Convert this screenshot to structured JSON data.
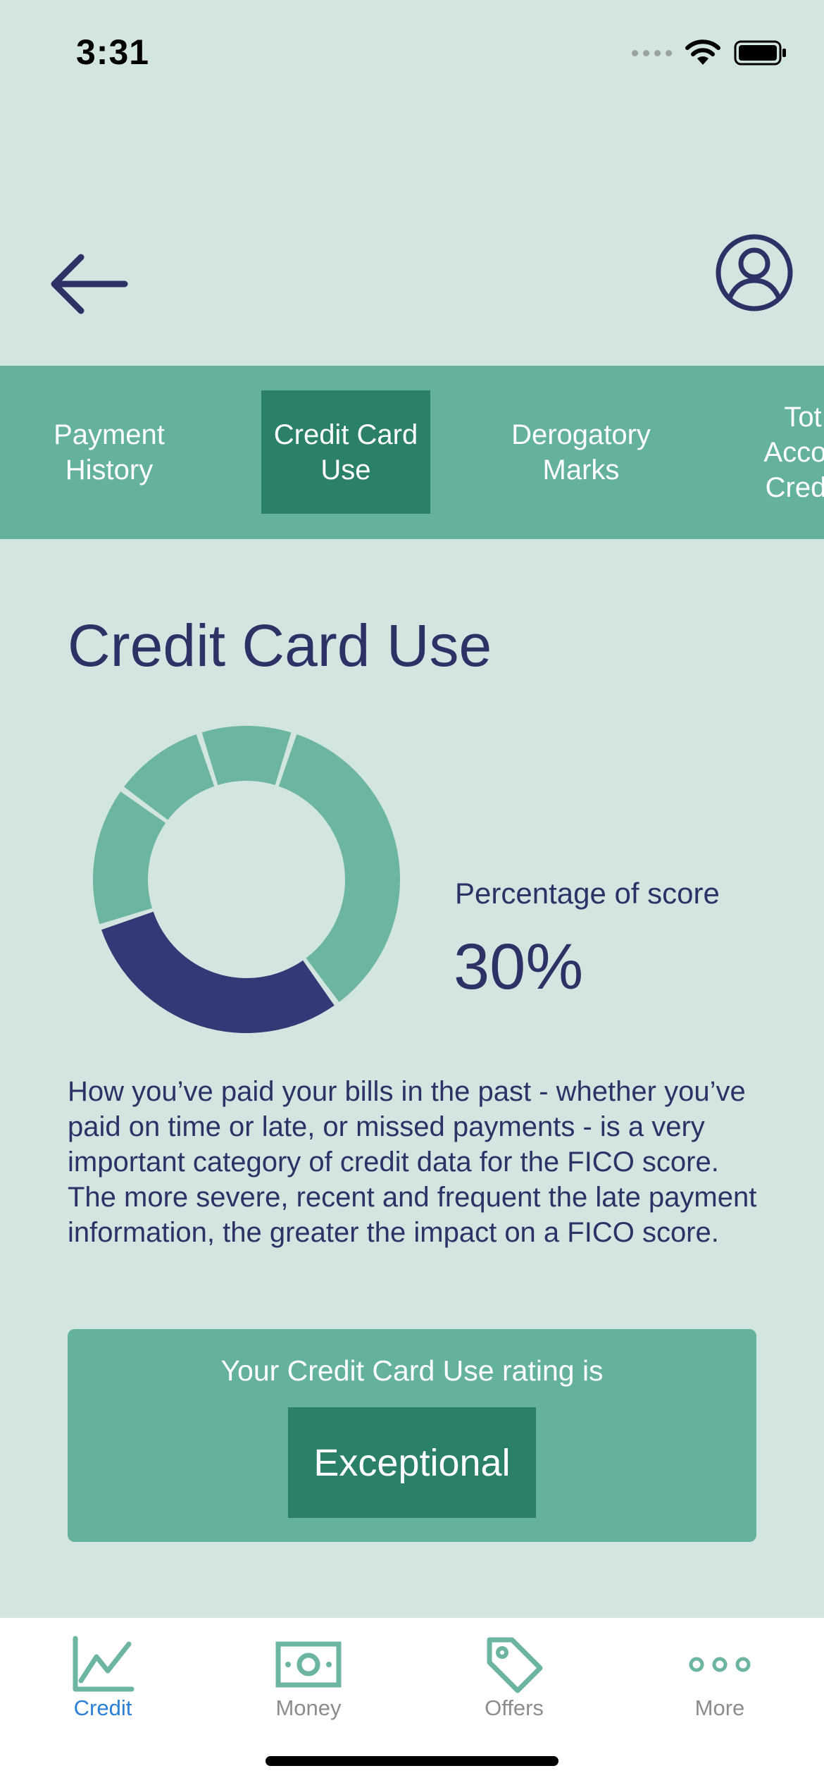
{
  "status_bar": {
    "time": "3:31"
  },
  "header": {
    "back_icon": "arrow-left-icon",
    "profile_icon": "user-circle-icon"
  },
  "tabs": [
    {
      "label": "Payment\nHistory",
      "active": false
    },
    {
      "label": "Credit Card\nUse",
      "active": true
    },
    {
      "label": "Derogatory\nMarks",
      "active": false
    },
    {
      "label": "Tot\nAccou\nCredit",
      "active": false
    }
  ],
  "main": {
    "title": "Credit Card Use",
    "score_label": "Percentage of score",
    "score_value": "30%",
    "score_fraction": 0.3,
    "description": "How you’ve paid your bills in the past - whether you’ve paid on time or late, or missed payments - is a very important category of credit data for the FICO score. The more severe, recent and frequent the late payment information, the greater the impact on a FICO score."
  },
  "donut_segments": [
    {
      "name": "credit-card-use",
      "percent": 30,
      "color": "#333876",
      "highlighted": true
    },
    {
      "name": "segment-2",
      "percent": 15,
      "color": "#6bb5a1",
      "highlighted": false
    },
    {
      "name": "segment-3",
      "percent": 10,
      "color": "#6bb5a1",
      "highlighted": false
    },
    {
      "name": "segment-4",
      "percent": 10,
      "color": "#6bb5a1",
      "highlighted": false
    },
    {
      "name": "segment-5",
      "percent": 35,
      "color": "#6bb5a1",
      "highlighted": false
    }
  ],
  "rating": {
    "text": "Your Credit Card Use rating is",
    "value": "Exceptional"
  },
  "tab_bar": [
    {
      "label": "Credit",
      "icon": "chart-line-icon",
      "active": true
    },
    {
      "label": "Money",
      "icon": "banknote-icon",
      "active": false
    },
    {
      "label": "Offers",
      "icon": "tag-icon",
      "active": false
    },
    {
      "label": "More",
      "icon": "more-dots-icon",
      "active": false
    }
  ],
  "colors": {
    "background": "#d3e5e0",
    "tab_strip": "#64b29e",
    "active_tab": "#2b8068",
    "navy": "#2d3266",
    "donut_highlight": "#333876",
    "donut_other": "#6bb5a1",
    "tab_bar_active": "#2b80d6",
    "tab_bar_inactive": "#8c8c8c",
    "tab_bar_icon": "#6bb5a1"
  }
}
